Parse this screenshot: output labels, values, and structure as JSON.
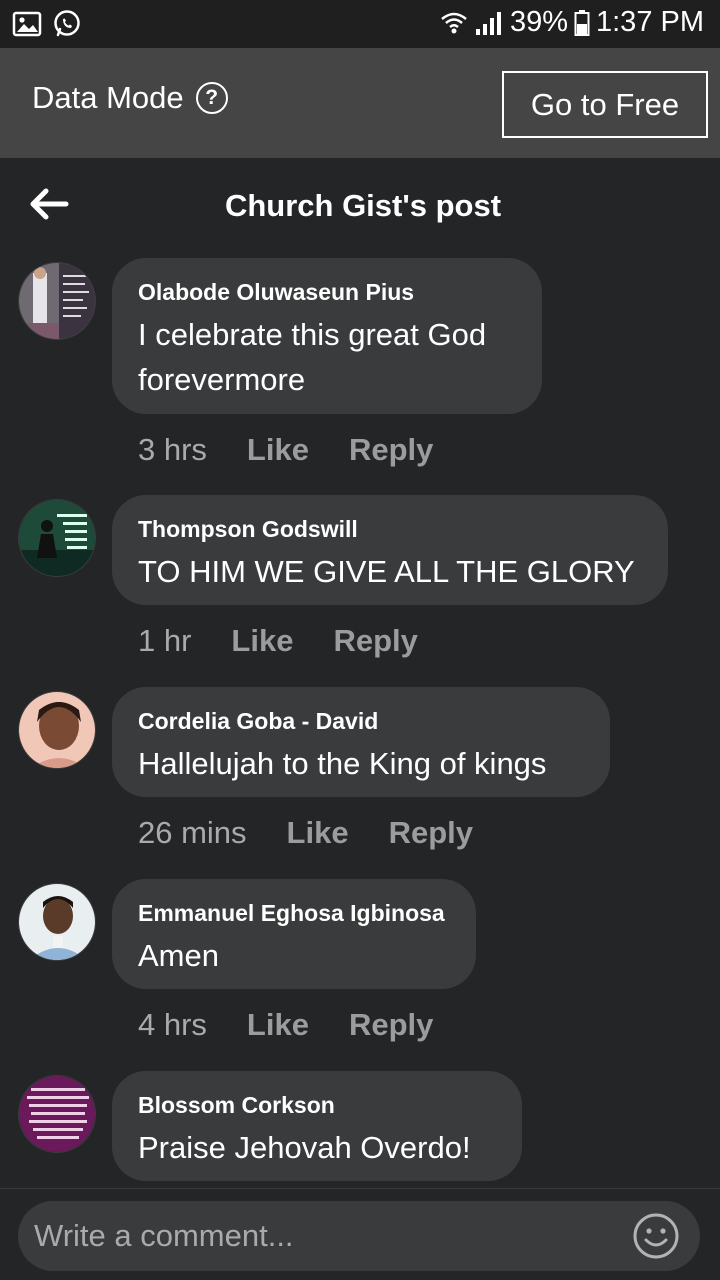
{
  "status_bar": {
    "battery": "39%",
    "time": "1:37 PM",
    "left_icons": [
      "gallery-icon",
      "whatsapp-icon"
    ],
    "right_icons": [
      "wifi-icon",
      "signal-icon",
      "battery-icon"
    ]
  },
  "data_bar": {
    "label": "Data Mode",
    "help_glyph": "?",
    "button_label": "Go to Free"
  },
  "header": {
    "title": "Church Gist's post",
    "back_icon": "back-arrow-icon"
  },
  "comments": [
    {
      "name": "Olabode Oluwaseun Pius",
      "text": "I celebrate this great God forevermore",
      "time": "3 hrs",
      "like": "Like",
      "reply": "Reply"
    },
    {
      "name": "Thompson Godswill",
      "text": "TO HIM WE GIVE ALL THE GLORY",
      "time": "1 hr",
      "like": "Like",
      "reply": "Reply"
    },
    {
      "name": "Cordelia Goba - David",
      "text": "Hallelujah to the King of kings",
      "time": "26 mins",
      "like": "Like",
      "reply": "Reply"
    },
    {
      "name": "Emmanuel Eghosa Igbinosa",
      "text": "Amen",
      "time": "4 hrs",
      "like": "Like",
      "reply": "Reply"
    },
    {
      "name": "Blossom Corkson",
      "text": "Praise Jehovah Overdo!",
      "time": "",
      "like": "",
      "reply": ""
    }
  ],
  "composer": {
    "placeholder": "Write a comment...",
    "emoji_icon": "emoji-icon"
  },
  "colors": {
    "background": "#242526",
    "bubble": "#3a3b3c",
    "data_bar": "#454545",
    "status_bar": "#1f1f1f",
    "meta_text": "#9a9c9f"
  }
}
